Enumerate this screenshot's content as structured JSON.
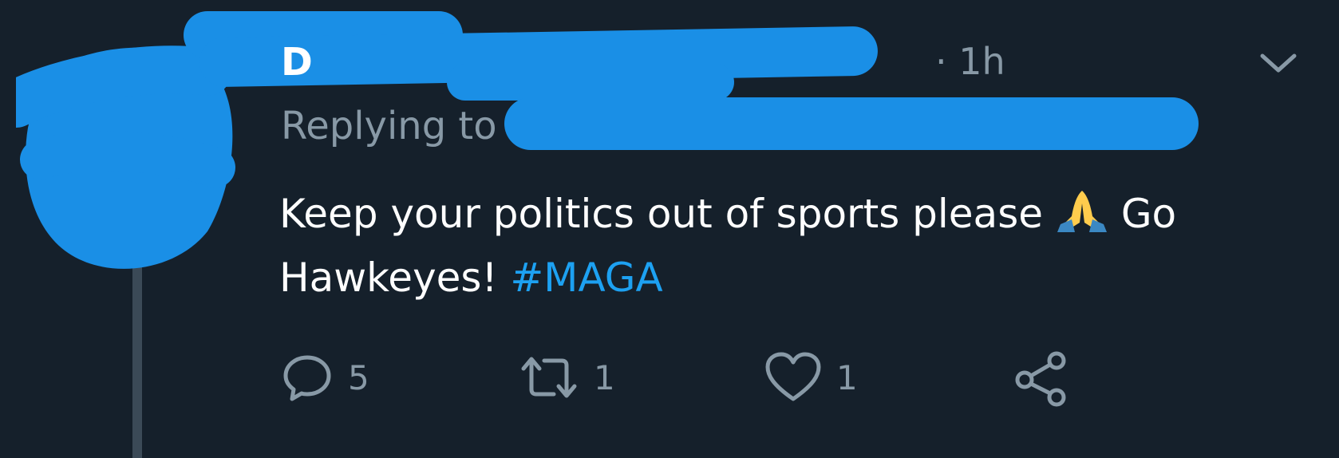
{
  "tweet": {
    "name": "D",
    "time": "· 1h",
    "replying_label": "Replying to",
    "text_main": "Keep your politics out of sports please",
    "text_after_emoji": " Go Hawkeyes! ",
    "hashtag": "#MAGA",
    "emoji": "folded-hands"
  },
  "actions": {
    "reply_count": "5",
    "retweet_count": "1",
    "like_count": "1"
  },
  "colors": {
    "background": "#15202b",
    "muted": "#8899a6",
    "hashtag": "#1da1f2",
    "redaction": "#1a8fe6"
  },
  "icons": [
    "chevron-down-icon",
    "reply-icon",
    "retweet-icon",
    "like-icon",
    "share-icon"
  ]
}
